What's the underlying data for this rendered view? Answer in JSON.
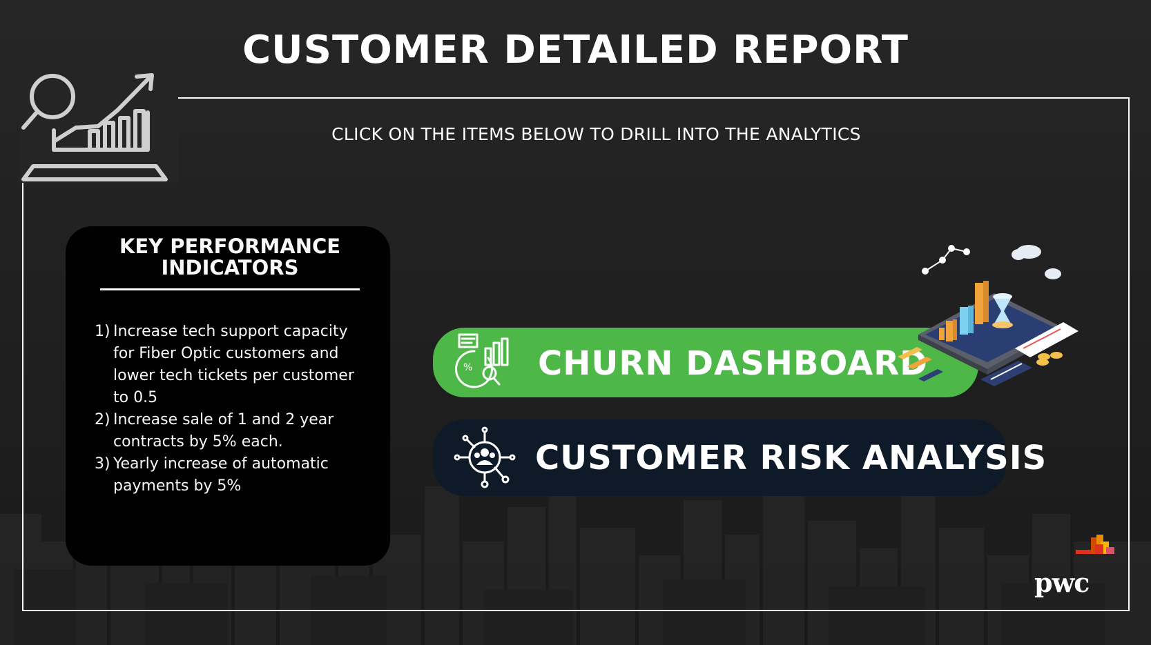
{
  "page": {
    "title": "CUSTOMER DETAILED REPORT",
    "subtitle": "CLICK ON THE ITEMS BELOW TO DRILL INTO THE ANALYTICS"
  },
  "kpi": {
    "title": "KEY PERFORMANCE INDICATORS",
    "items": [
      {
        "num": "1)",
        "text": "Increase tech support capacity for Fiber Optic customers and lower tech tickets per customer to 0.5"
      },
      {
        "num": "2)",
        "text": "Increase sale of 1 and 2 year contracts by 5% each."
      },
      {
        "num": "3)",
        "text": "Yearly increase of automatic payments by 5%"
      }
    ]
  },
  "buttons": {
    "churn": {
      "label": "CHURN DASHBOARD",
      "icon": "analytics-chart-icon"
    },
    "risk": {
      "label": "CUSTOMER RISK ANALYSIS",
      "icon": "customer-network-icon"
    }
  },
  "brand": {
    "name": "pwc",
    "logo_colors": [
      "#e0301e",
      "#eb8c00",
      "#ffb600",
      "#d04a02",
      "#db536a"
    ]
  },
  "colors": {
    "background": "#1e1e1e",
    "churn_button": "#4db848",
    "risk_button": "#0f1a28",
    "text": "#ffffff"
  }
}
